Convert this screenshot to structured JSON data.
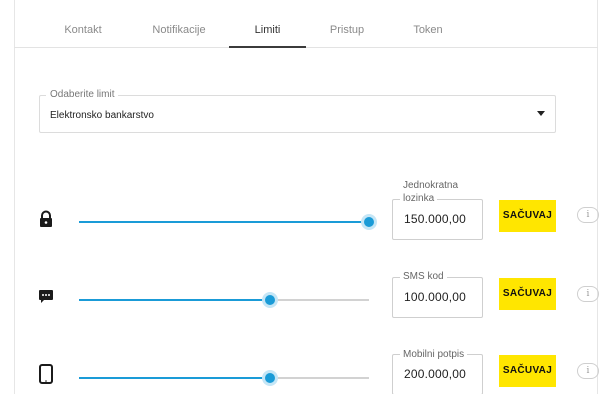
{
  "tabs": [
    {
      "label": "Kontakt",
      "active": false
    },
    {
      "label": "Notifikacije",
      "active": false
    },
    {
      "label": "Limiti",
      "active": true
    },
    {
      "label": "Pristup",
      "active": false
    },
    {
      "label": "Token",
      "active": false
    }
  ],
  "limit_select": {
    "label": "Odaberite limit",
    "value": "Elektronsko bankarstvo"
  },
  "limits": [
    {
      "icon": "lock-icon",
      "field_label_line1": "Jednokratna",
      "field_label_line2": "lozinka",
      "value": "150.000,00",
      "slider_fraction": 1.0,
      "save_label": "SAČUVAJ",
      "info_label": "i"
    },
    {
      "icon": "sms-icon",
      "field_label_line1": "SMS kod",
      "field_label_line2": "",
      "value": "100.000,00",
      "slider_fraction": 0.66,
      "save_label": "SAČUVAJ",
      "info_label": "i"
    },
    {
      "icon": "mobile-icon",
      "field_label_line1": "Mobilni potpis",
      "field_label_line2": "",
      "value": "200.000,00",
      "slider_fraction": 0.66,
      "save_label": "SAČUVAJ",
      "info_label": "i"
    }
  ],
  "colors": {
    "accent": "#1a9bd7",
    "save_button": "#ffe600",
    "track": "#d2d2d2"
  }
}
